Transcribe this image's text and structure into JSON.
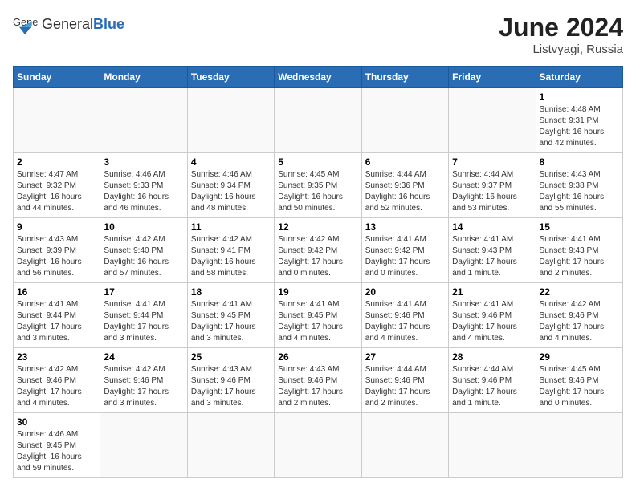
{
  "header": {
    "logo_general": "General",
    "logo_blue": "Blue",
    "month_title": "June 2024",
    "location": "Listvyagi, Russia"
  },
  "weekdays": [
    "Sunday",
    "Monday",
    "Tuesday",
    "Wednesday",
    "Thursday",
    "Friday",
    "Saturday"
  ],
  "weeks": [
    [
      {
        "day": "",
        "info": ""
      },
      {
        "day": "",
        "info": ""
      },
      {
        "day": "",
        "info": ""
      },
      {
        "day": "",
        "info": ""
      },
      {
        "day": "",
        "info": ""
      },
      {
        "day": "",
        "info": ""
      },
      {
        "day": "1",
        "info": "Sunrise: 4:48 AM\nSunset: 9:31 PM\nDaylight: 16 hours and 42 minutes."
      }
    ],
    [
      {
        "day": "2",
        "info": "Sunrise: 4:47 AM\nSunset: 9:32 PM\nDaylight: 16 hours and 44 minutes."
      },
      {
        "day": "3",
        "info": "Sunrise: 4:46 AM\nSunset: 9:33 PM\nDaylight: 16 hours and 46 minutes."
      },
      {
        "day": "4",
        "info": "Sunrise: 4:46 AM\nSunset: 9:34 PM\nDaylight: 16 hours and 48 minutes."
      },
      {
        "day": "5",
        "info": "Sunrise: 4:45 AM\nSunset: 9:35 PM\nDaylight: 16 hours and 50 minutes."
      },
      {
        "day": "6",
        "info": "Sunrise: 4:44 AM\nSunset: 9:36 PM\nDaylight: 16 hours and 52 minutes."
      },
      {
        "day": "7",
        "info": "Sunrise: 4:44 AM\nSunset: 9:37 PM\nDaylight: 16 hours and 53 minutes."
      },
      {
        "day": "8",
        "info": "Sunrise: 4:43 AM\nSunset: 9:38 PM\nDaylight: 16 hours and 55 minutes."
      }
    ],
    [
      {
        "day": "9",
        "info": "Sunrise: 4:43 AM\nSunset: 9:39 PM\nDaylight: 16 hours and 56 minutes."
      },
      {
        "day": "10",
        "info": "Sunrise: 4:42 AM\nSunset: 9:40 PM\nDaylight: 16 hours and 57 minutes."
      },
      {
        "day": "11",
        "info": "Sunrise: 4:42 AM\nSunset: 9:41 PM\nDaylight: 16 hours and 58 minutes."
      },
      {
        "day": "12",
        "info": "Sunrise: 4:42 AM\nSunset: 9:42 PM\nDaylight: 17 hours and 0 minutes."
      },
      {
        "day": "13",
        "info": "Sunrise: 4:41 AM\nSunset: 9:42 PM\nDaylight: 17 hours and 0 minutes."
      },
      {
        "day": "14",
        "info": "Sunrise: 4:41 AM\nSunset: 9:43 PM\nDaylight: 17 hours and 1 minute."
      },
      {
        "day": "15",
        "info": "Sunrise: 4:41 AM\nSunset: 9:43 PM\nDaylight: 17 hours and 2 minutes."
      }
    ],
    [
      {
        "day": "16",
        "info": "Sunrise: 4:41 AM\nSunset: 9:44 PM\nDaylight: 17 hours and 3 minutes."
      },
      {
        "day": "17",
        "info": "Sunrise: 4:41 AM\nSunset: 9:44 PM\nDaylight: 17 hours and 3 minutes."
      },
      {
        "day": "18",
        "info": "Sunrise: 4:41 AM\nSunset: 9:45 PM\nDaylight: 17 hours and 3 minutes."
      },
      {
        "day": "19",
        "info": "Sunrise: 4:41 AM\nSunset: 9:45 PM\nDaylight: 17 hours and 4 minutes."
      },
      {
        "day": "20",
        "info": "Sunrise: 4:41 AM\nSunset: 9:46 PM\nDaylight: 17 hours and 4 minutes."
      },
      {
        "day": "21",
        "info": "Sunrise: 4:41 AM\nSunset: 9:46 PM\nDaylight: 17 hours and 4 minutes."
      },
      {
        "day": "22",
        "info": "Sunrise: 4:42 AM\nSunset: 9:46 PM\nDaylight: 17 hours and 4 minutes."
      }
    ],
    [
      {
        "day": "23",
        "info": "Sunrise: 4:42 AM\nSunset: 9:46 PM\nDaylight: 17 hours and 4 minutes."
      },
      {
        "day": "24",
        "info": "Sunrise: 4:42 AM\nSunset: 9:46 PM\nDaylight: 17 hours and 3 minutes."
      },
      {
        "day": "25",
        "info": "Sunrise: 4:43 AM\nSunset: 9:46 PM\nDaylight: 17 hours and 3 minutes."
      },
      {
        "day": "26",
        "info": "Sunrise: 4:43 AM\nSunset: 9:46 PM\nDaylight: 17 hours and 2 minutes."
      },
      {
        "day": "27",
        "info": "Sunrise: 4:44 AM\nSunset: 9:46 PM\nDaylight: 17 hours and 2 minutes."
      },
      {
        "day": "28",
        "info": "Sunrise: 4:44 AM\nSunset: 9:46 PM\nDaylight: 17 hours and 1 minute."
      },
      {
        "day": "29",
        "info": "Sunrise: 4:45 AM\nSunset: 9:46 PM\nDaylight: 17 hours and 0 minutes."
      }
    ],
    [
      {
        "day": "30",
        "info": "Sunrise: 4:46 AM\nSunset: 9:45 PM\nDaylight: 16 hours and 59 minutes."
      },
      {
        "day": "",
        "info": ""
      },
      {
        "day": "",
        "info": ""
      },
      {
        "day": "",
        "info": ""
      },
      {
        "day": "",
        "info": ""
      },
      {
        "day": "",
        "info": ""
      },
      {
        "day": "",
        "info": ""
      }
    ]
  ]
}
